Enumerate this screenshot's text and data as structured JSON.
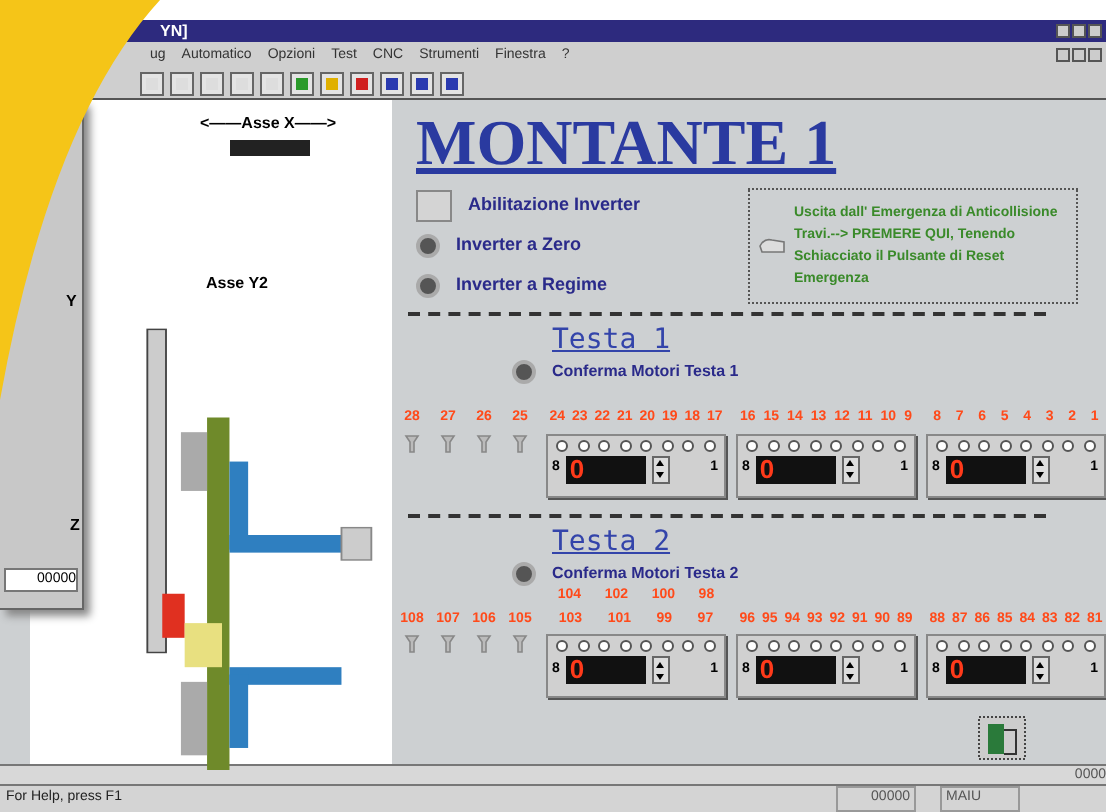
{
  "window": {
    "title": "YN]"
  },
  "menu": [
    "ug",
    "Automatico",
    "Opzioni",
    "Test",
    "CNC",
    "Strumenti",
    "Finestra",
    "?"
  ],
  "back_window": {
    "axis_y": "Y",
    "axis_z": "Z",
    "counter": "00000"
  },
  "drawing": {
    "axis_x": "<——Asse X——>",
    "axis_y2": "Asse Y2"
  },
  "title": "MONTANTE 1",
  "controls": [
    {
      "kind": "checkbox",
      "label": "Abilitazione Inverter",
      "checked": false
    },
    {
      "kind": "led",
      "label": "Inverter a Zero"
    },
    {
      "kind": "led",
      "label": "Inverter a Regime"
    }
  ],
  "emergency_note": "Uscita dall' Emergenza di Anticollisione Travi.--> PREMERE QUI, Tenendo Schiacciato il Pulsante di Reset Emergenza",
  "heads": [
    {
      "title": "Testa 1",
      "confirm": "Conferma Motori Testa 1",
      "tool_labels": [
        "28",
        "27",
        "26",
        "25"
      ],
      "groups": [
        {
          "labels": [
            "24",
            "23",
            "22",
            "21",
            "20",
            "19",
            "18",
            "17"
          ],
          "bits": [
            {
              "on": false
            },
            {
              "on": false
            },
            {
              "on": false
            },
            {
              "on": false
            },
            {
              "on": false
            },
            {
              "on": false
            },
            {
              "on": false
            },
            {
              "on": false
            }
          ],
          "low": "8",
          "display": "0",
          "high": "1"
        },
        {
          "labels": [
            "16",
            "15",
            "14",
            "13",
            "12",
            "11",
            "10",
            "9"
          ],
          "bits": [
            {
              "on": false
            },
            {
              "on": false
            },
            {
              "on": false
            },
            {
              "on": false
            },
            {
              "on": false
            },
            {
              "on": false
            },
            {
              "on": false
            },
            {
              "on": false
            }
          ],
          "low": "8",
          "display": "0",
          "high": "1"
        },
        {
          "labels": [
            "8",
            "7",
            "6",
            "5",
            "4",
            "3",
            "2",
            "1"
          ],
          "bits": [
            {
              "on": false
            },
            {
              "on": false
            },
            {
              "on": false
            },
            {
              "on": false
            },
            {
              "on": false
            },
            {
              "on": false
            },
            {
              "on": false
            },
            {
              "on": false
            }
          ],
          "low": "8",
          "display": "0",
          "high": "1"
        }
      ]
    },
    {
      "title": "Testa 2",
      "confirm": "Conferma Motori Testa 2",
      "top_labels": [
        "104",
        "102",
        "100",
        "98"
      ],
      "tool_labels": [
        "108",
        "107",
        "106",
        "105"
      ],
      "groups": [
        {
          "labels": [
            "103",
            "101",
            "99",
            "97"
          ],
          "bits": [
            {
              "on": false
            },
            {
              "on": false
            },
            {
              "on": false
            },
            {
              "on": false
            },
            {
              "on": false
            },
            {
              "on": false
            },
            {
              "on": false
            },
            {
              "on": false
            }
          ],
          "low": "8",
          "display": "0",
          "high": "1"
        },
        {
          "labels": [
            "96",
            "95",
            "94",
            "93",
            "92",
            "91",
            "90",
            "89"
          ],
          "bits": [
            {
              "on": false
            },
            {
              "on": false
            },
            {
              "on": false
            },
            {
              "on": false
            },
            {
              "on": false
            },
            {
              "on": false
            },
            {
              "on": false
            },
            {
              "on": false
            }
          ],
          "low": "8",
          "display": "0",
          "high": "1"
        },
        {
          "labels": [
            "88",
            "87",
            "86",
            "85",
            "84",
            "83",
            "82",
            "81"
          ],
          "bits": [
            {
              "on": false
            },
            {
              "on": false
            },
            {
              "on": false
            },
            {
              "on": false
            },
            {
              "on": false
            },
            {
              "on": false
            },
            {
              "on": false
            },
            {
              "on": false
            }
          ],
          "low": "8",
          "display": "0",
          "high": "1"
        }
      ]
    }
  ],
  "scroll_counter": "0000",
  "status_bar": {
    "help": "For Help, press F1",
    "counter": "00000",
    "mode": "MAIU"
  }
}
